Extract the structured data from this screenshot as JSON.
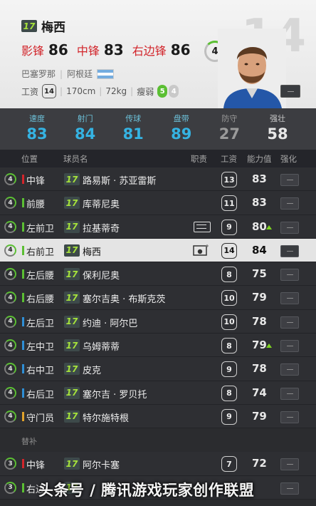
{
  "player": {
    "badge": "17",
    "name": "梅西",
    "number": "14",
    "positions": [
      {
        "name": "影锋",
        "value": "86"
      },
      {
        "name": "中锋",
        "value": "83"
      },
      {
        "name": "右边锋",
        "value": "86"
      }
    ],
    "skill_level": "4",
    "club": "巴塞罗那",
    "nation": "阿根廷",
    "wage_label": "工资",
    "wage": "14",
    "height": "170cm",
    "weight": "72kg",
    "build": "瘦弱",
    "weak_foot_a": "5",
    "weak_foot_b": "4"
  },
  "attributes": [
    {
      "name": "速度",
      "value": "83"
    },
    {
      "name": "射门",
      "value": "84"
    },
    {
      "name": "传球",
      "value": "81"
    },
    {
      "name": "盘带",
      "value": "89"
    },
    {
      "name": "防守",
      "value": "27"
    },
    {
      "name": "强壮",
      "value": "58"
    }
  ],
  "table_headers": {
    "position": "位置",
    "name": "球员名",
    "duty": "职责",
    "wage": "工资",
    "rating": "能力值",
    "upgrade": "强化"
  },
  "starters": [
    {
      "level": "4",
      "pos": "中锋",
      "posColor": "#d2252b",
      "badge": "17",
      "name": "路易斯 · 苏亚雷斯",
      "duty": "",
      "wage": "13",
      "rating": "83",
      "up": false
    },
    {
      "level": "4",
      "pos": "前腰",
      "posColor": "#5bbf33",
      "badge": "17",
      "name": "库蒂尼奥",
      "duty": "",
      "wage": "11",
      "rating": "83",
      "up": false
    },
    {
      "level": "4",
      "pos": "左前卫",
      "posColor": "#5bbf33",
      "badge": "17",
      "name": "拉基蒂奇",
      "duty": "captain",
      "wage": "9",
      "rating": "80",
      "up": true
    },
    {
      "level": "4",
      "pos": "右前卫",
      "posColor": "#5bbf33",
      "badge": "17",
      "name": "梅西",
      "duty": "freekick",
      "wage": "14",
      "rating": "84",
      "up": false,
      "selected": true
    },
    {
      "level": "4",
      "pos": "左后腰",
      "posColor": "#5bbf33",
      "badge": "17",
      "name": "保利尼奥",
      "duty": "",
      "wage": "8",
      "rating": "75",
      "up": false
    },
    {
      "level": "4",
      "pos": "右后腰",
      "posColor": "#5bbf33",
      "badge": "17",
      "name": "塞尔吉奥 · 布斯克茨",
      "duty": "",
      "wage": "10",
      "rating": "79",
      "up": false
    },
    {
      "level": "4",
      "pos": "左后卫",
      "posColor": "#2f8fd6",
      "badge": "17",
      "name": "约迪 · 阿尔巴",
      "duty": "",
      "wage": "10",
      "rating": "78",
      "up": false
    },
    {
      "level": "4",
      "pos": "左中卫",
      "posColor": "#2f8fd6",
      "badge": "17",
      "name": "乌姆蒂蒂",
      "duty": "",
      "wage": "8",
      "rating": "79",
      "up": true
    },
    {
      "level": "4",
      "pos": "右中卫",
      "posColor": "#2f8fd6",
      "badge": "17",
      "name": "皮克",
      "duty": "",
      "wage": "9",
      "rating": "78",
      "up": false
    },
    {
      "level": "4",
      "pos": "右后卫",
      "posColor": "#2f8fd6",
      "badge": "17",
      "name": "塞尔吉 · 罗贝托",
      "duty": "",
      "wage": "8",
      "rating": "74",
      "up": false
    },
    {
      "level": "4",
      "pos": "守门员",
      "posColor": "#e0a22b",
      "badge": "17",
      "name": "特尔施特根",
      "duty": "",
      "wage": "9",
      "rating": "79",
      "up": false
    }
  ],
  "subs_label": "替补",
  "subs": [
    {
      "level": "3",
      "pos": "中锋",
      "posColor": "#d2252b",
      "badge": "17",
      "name": "阿尔卡塞",
      "duty": "",
      "wage": "7",
      "rating": "72",
      "up": false
    },
    {
      "level": "3",
      "pos": "右边",
      "posColor": "#5bbf33",
      "badge": "17",
      "name": "",
      "duty": "",
      "wage": "",
      "rating": "",
      "up": false
    }
  ],
  "watermark": "头条号 / 腾讯游戏玩家创作联盟"
}
